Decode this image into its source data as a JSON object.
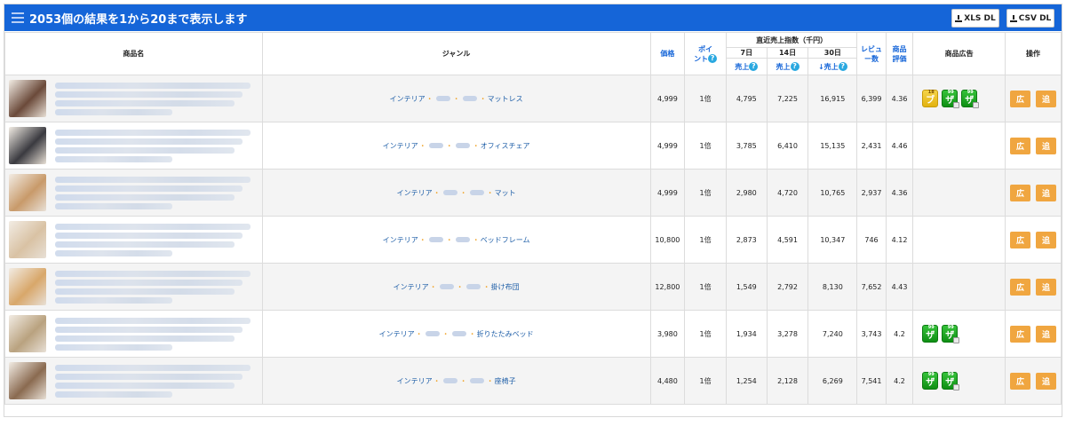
{
  "header": {
    "title": "2053個の結果を1から20まで表示します",
    "xls_label": "XLS DL",
    "csv_label": "CSV DL"
  },
  "columns": {
    "name": "商品名",
    "genre": "ジャンル",
    "price": "価格",
    "point_a": "ポイ",
    "point_b": "ント",
    "sales_group": "直近売上指数（千円）",
    "d7": "7日",
    "d14": "14日",
    "d30": "30日",
    "sales_label": "売上",
    "sales_label_sorted": "↓売上",
    "review_a": "レビュ",
    "review_b": "ー数",
    "rating_a": "商品",
    "rating_b": "評価",
    "ad": "商品広告",
    "ops": "操作"
  },
  "ops_labels": {
    "ad": "広",
    "add": "追"
  },
  "rows": [
    {
      "genre_main": "インテリア",
      "genre_last": "マットレス",
      "price": "4,999",
      "point": "1倍",
      "d7": "4,795",
      "d14": "7,225",
      "d30": "16,915",
      "reviews": "6,399",
      "rating": "4.36",
      "thumb": "#6b4a3a",
      "badges": [
        "yellow",
        "green",
        "green"
      ]
    },
    {
      "genre_main": "インテリア",
      "genre_last": "オフィスチェア",
      "price": "4,999",
      "point": "1倍",
      "d7": "3,785",
      "d14": "6,410",
      "d30": "15,135",
      "reviews": "2,431",
      "rating": "4.46",
      "thumb": "#3a3a40",
      "badges": []
    },
    {
      "genre_main": "インテリア",
      "genre_last": "マット",
      "price": "4,999",
      "point": "1倍",
      "d7": "2,980",
      "d14": "4,720",
      "d30": "10,765",
      "reviews": "2,937",
      "rating": "4.36",
      "thumb": "#c89a6a",
      "badges": []
    },
    {
      "genre_main": "インテリア",
      "genre_last": "ベッドフレーム",
      "price": "10,800",
      "point": "1倍",
      "d7": "2,873",
      "d14": "4,591",
      "d30": "10,347",
      "reviews": "746",
      "rating": "4.12",
      "thumb": "#d9c2a4",
      "badges": []
    },
    {
      "genre_main": "インテリア",
      "genre_last": "掛け布団",
      "price": "12,800",
      "point": "1倍",
      "d7": "1,549",
      "d14": "2,792",
      "d30": "8,130",
      "reviews": "7,652",
      "rating": "4.43",
      "thumb": "#d8a76a",
      "badges": []
    },
    {
      "genre_main": "インテリア",
      "genre_last": "折りたたみベッド",
      "price": "3,980",
      "point": "1倍",
      "d7": "1,934",
      "d14": "3,278",
      "d30": "7,240",
      "reviews": "3,743",
      "rating": "4.2",
      "thumb": "#b9a27f",
      "badges": [
        "green",
        "green"
      ]
    },
    {
      "genre_main": "インテリア",
      "genre_last": "座椅子",
      "price": "4,480",
      "point": "1倍",
      "d7": "1,254",
      "d14": "2,128",
      "d30": "6,269",
      "reviews": "7,541",
      "rating": "4.2",
      "thumb": "#8a6a50",
      "badges": [
        "green",
        "green"
      ]
    }
  ],
  "badge_texts": {
    "yellow_sup": "18",
    "yellow_main": "ブ",
    "green_sup": "99",
    "green_main": "ザ"
  }
}
